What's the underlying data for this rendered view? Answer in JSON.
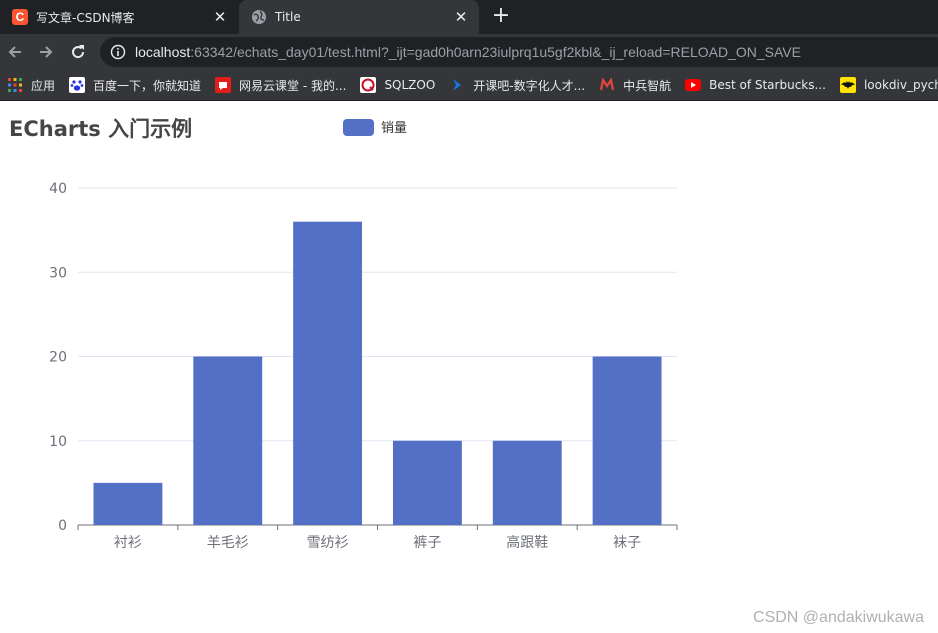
{
  "browser": {
    "tabs": [
      {
        "title": "写文章-CSDN博客",
        "favicon": "csdn-logo-icon",
        "active": false
      },
      {
        "title": "Title",
        "favicon": "globe-icon",
        "active": true
      }
    ],
    "close_glyph": "✕",
    "new_tab_glyph": "+",
    "url": {
      "host": "localhost",
      "rest": ":63342/echats_day01/test.html?_ijt=gad0h0arn23iulprq1u5gf2kbl&_ij_reload=RELOAD_ON_SAVE"
    },
    "bookmarks": [
      {
        "label": "应用",
        "icon": "apps-grid-icon"
      },
      {
        "label": "百度一下，你就知道",
        "icon": "baidu-paw-icon"
      },
      {
        "label": "网易云课堂 - 我的...",
        "icon": "netease-study-icon"
      },
      {
        "label": "SQLZOO",
        "icon": "sqlzoo-icon"
      },
      {
        "label": "开课吧-数字化人才...",
        "icon": "kaikeba-icon"
      },
      {
        "label": "中兵智航",
        "icon": "m-logo-icon"
      },
      {
        "label": "Best of Starbucks...",
        "icon": "youtube-icon"
      },
      {
        "label": "lookdiv_pych",
        "icon": "batman-icon"
      }
    ]
  },
  "page": {
    "watermark": "CSDN @andakiwukawa"
  },
  "chart_data": {
    "type": "bar",
    "title": "ECharts 入门示例",
    "legend": [
      "销量"
    ],
    "legend_position": "top-center",
    "categories": [
      "衬衫",
      "羊毛衫",
      "雪纺衫",
      "裤子",
      "高跟鞋",
      "袜子"
    ],
    "series": [
      {
        "name": "销量",
        "values": [
          5,
          20,
          36,
          10,
          10,
          20
        ],
        "color": "#5470c6"
      }
    ],
    "ylim": [
      0,
      40
    ],
    "yticks": [
      0,
      10,
      20,
      30,
      40
    ],
    "grid": true
  }
}
